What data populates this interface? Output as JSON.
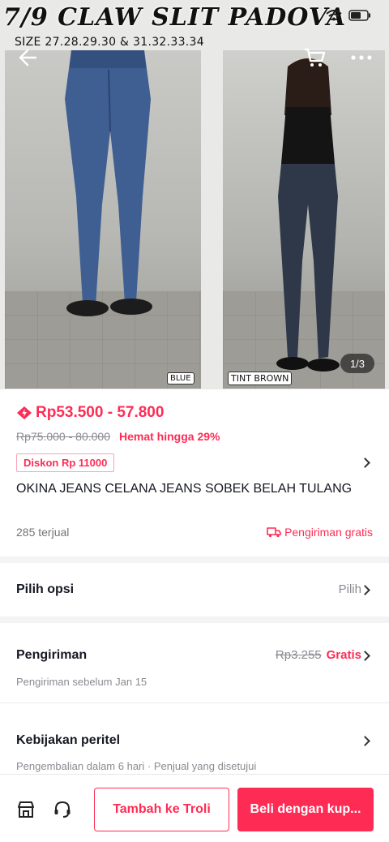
{
  "gallery": {
    "overlay_title": "7/9 CLAW SLIT PADOVA",
    "overlay_sizes": "SIZE  27.28.29.30 & 31.32.33.34",
    "tag_left": "BLUE",
    "tag_right": "TINT BROWN",
    "counter": "1/3"
  },
  "icons": {
    "back": "back-arrow-icon",
    "cart": "cart-icon",
    "more": "more-icon",
    "store": "store-icon",
    "support": "headset-icon",
    "flash": "flash-sale-icon",
    "truck": "truck-icon",
    "chevron": "chevron-right-icon"
  },
  "product": {
    "price": "Rp53.500 - 57.800",
    "original_price": "Rp75.000 - 80.000",
    "saving": "Hemat hingga 29%",
    "discount_badge": "Diskon Rp 11000",
    "title": "OKINA JEANS CELANA JEANS SOBEK BELAH TULANG",
    "sold": "285 terjual",
    "free_shipping": "Pengiriman gratis"
  },
  "options": {
    "label": "Pilih opsi",
    "action": "Pilih"
  },
  "shipping": {
    "label": "Pengiriman",
    "old_price": "Rp3.255",
    "free": "Gratis",
    "note": "Pengiriman sebelum Jan 15"
  },
  "policy": {
    "label": "Kebijakan peritel",
    "note": "Pengembalian dalam 6 hari · Penjual yang disetujui"
  },
  "actions": {
    "add_to_cart": "Tambah ke Troli",
    "buy": "Beli dengan kup..."
  },
  "colors": {
    "accent": "#fe2c55",
    "text": "#161823",
    "muted": "#8a8b91"
  }
}
